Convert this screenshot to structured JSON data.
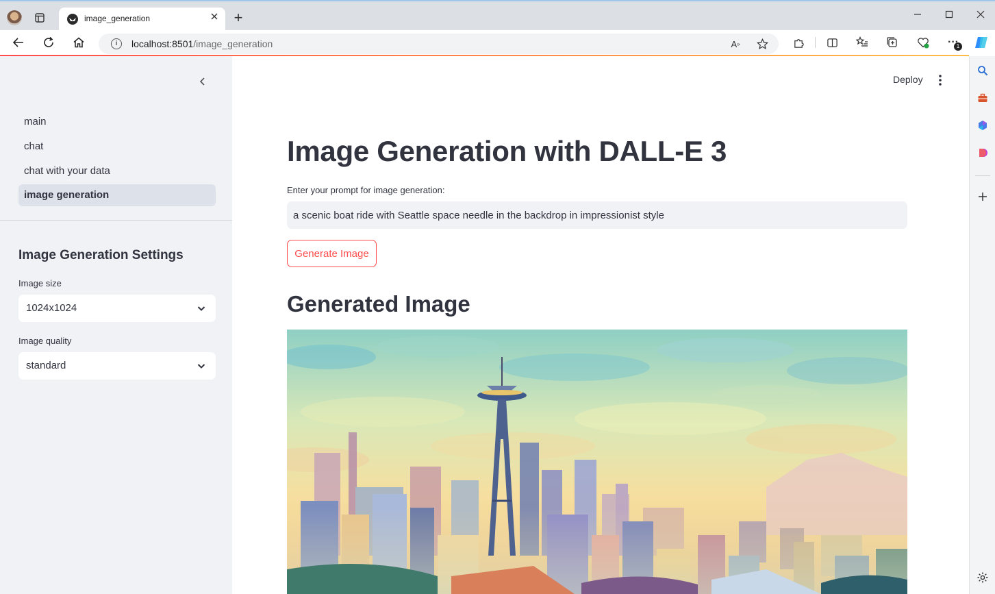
{
  "browser": {
    "tab_title": "image_generation",
    "url_host": "localhost:8501",
    "url_path": "/image_generation",
    "new_tab_label": "+",
    "extension_badge": "1"
  },
  "sidebar": {
    "nav_items": [
      {
        "label": "main"
      },
      {
        "label": "chat"
      },
      {
        "label": "chat with your data"
      },
      {
        "label": "image generation",
        "active": true
      }
    ],
    "settings_title": "Image Generation Settings",
    "image_size_label": "Image size",
    "image_size_value": "1024x1024",
    "image_quality_label": "Image quality",
    "image_quality_value": "standard"
  },
  "header": {
    "deploy_label": "Deploy"
  },
  "main": {
    "title": "Image Generation with DALL-E 3",
    "prompt_label": "Enter your prompt for image generation:",
    "prompt_value": "a scenic boat ride with Seattle space needle in the backdrop in impressionist style",
    "generate_button": "Generate Image",
    "generated_heading": "Generated Image"
  },
  "colors": {
    "accent": "#ff4b4b",
    "sidebar_bg": "#f0f2f6",
    "text": "#31333f"
  }
}
